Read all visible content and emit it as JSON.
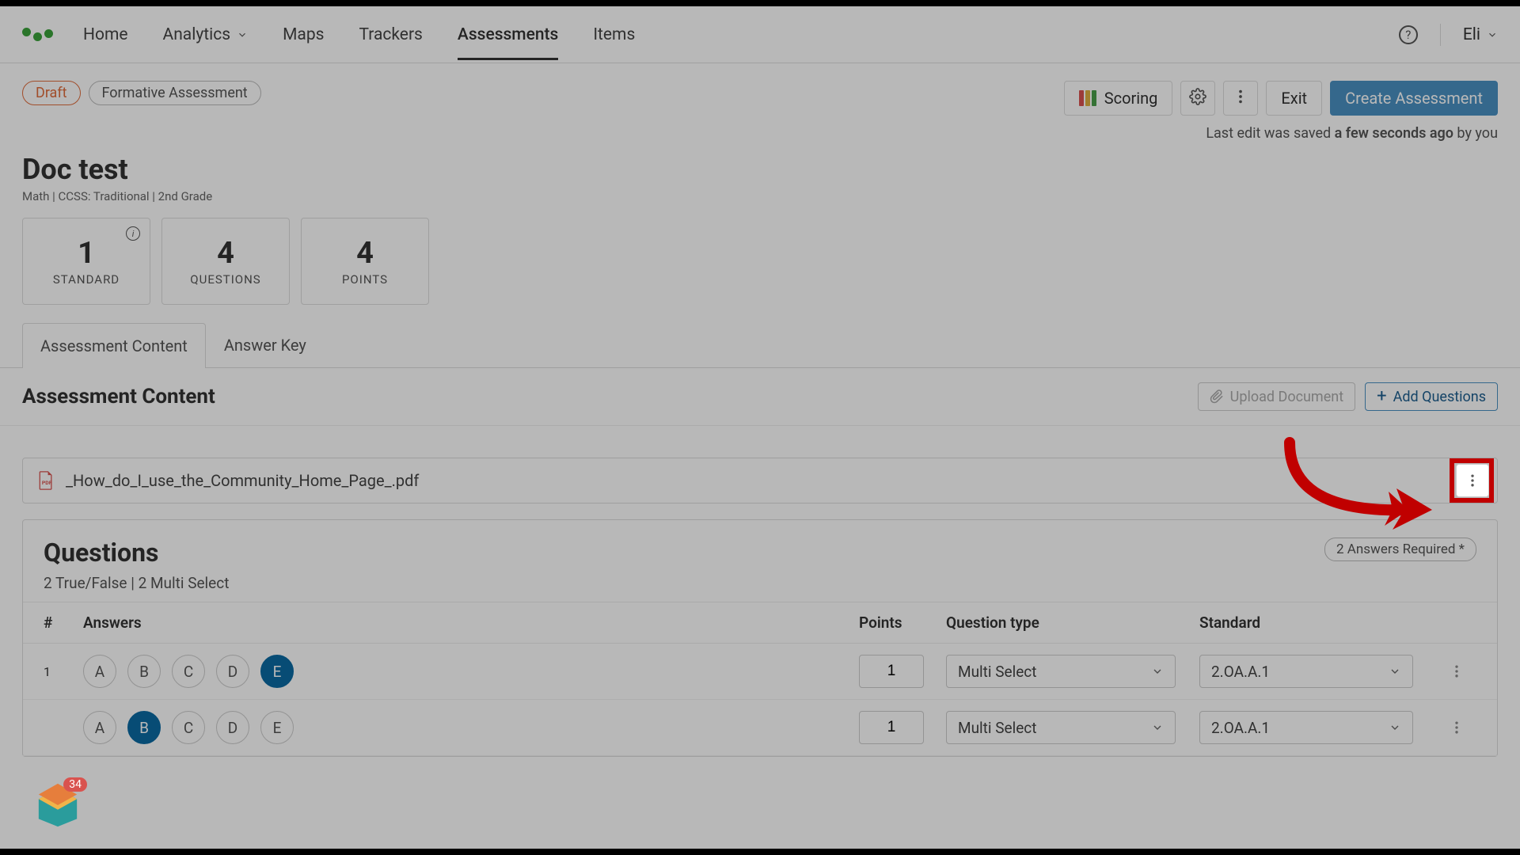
{
  "nav": {
    "items": [
      "Home",
      "Analytics",
      "Maps",
      "Trackers",
      "Assessments",
      "Items"
    ],
    "user": "Eli"
  },
  "badges": {
    "draft": "Draft",
    "formative": "Formative Assessment"
  },
  "toolbar": {
    "scoring": "Scoring",
    "exit": "Exit",
    "create": "Create Assessment"
  },
  "saved": {
    "prefix": "Last edit was saved ",
    "when": "a few seconds ago",
    "by": " by you"
  },
  "title": "Doc test",
  "meta": "Math  |  CCSS: Traditional  |  2nd Grade",
  "stats": [
    {
      "num": "1",
      "label": "STANDARD",
      "info": true
    },
    {
      "num": "4",
      "label": "QUESTIONS"
    },
    {
      "num": "4",
      "label": "POINTS"
    }
  ],
  "tabs": [
    "Assessment Content",
    "Answer Key"
  ],
  "section": {
    "title": "Assessment Content",
    "upload": "Upload Document",
    "add": "Add Questions"
  },
  "file": "_How_do_I_use_the_Community_Home_Page_.pdf",
  "questions": {
    "title": "Questions",
    "subtitle": "2 True/False | 2 Multi Select",
    "pill": "2 Answers Required *",
    "headers": {
      "num": "#",
      "answers": "Answers",
      "points": "Points",
      "type": "Question type",
      "standard": "Standard"
    },
    "rows": [
      {
        "n": "1",
        "choices": [
          "A",
          "B",
          "C",
          "D",
          "E"
        ],
        "selected": [
          "E"
        ],
        "points": "1",
        "type": "Multi Select",
        "standard": "2.OA.A.1"
      },
      {
        "n": "",
        "choices": [
          "A",
          "B",
          "C",
          "D",
          "E"
        ],
        "selected": [
          "B"
        ],
        "points": "1",
        "type": "Multi Select",
        "standard": "2.OA.A.1"
      }
    ]
  },
  "widget_badge": "34"
}
